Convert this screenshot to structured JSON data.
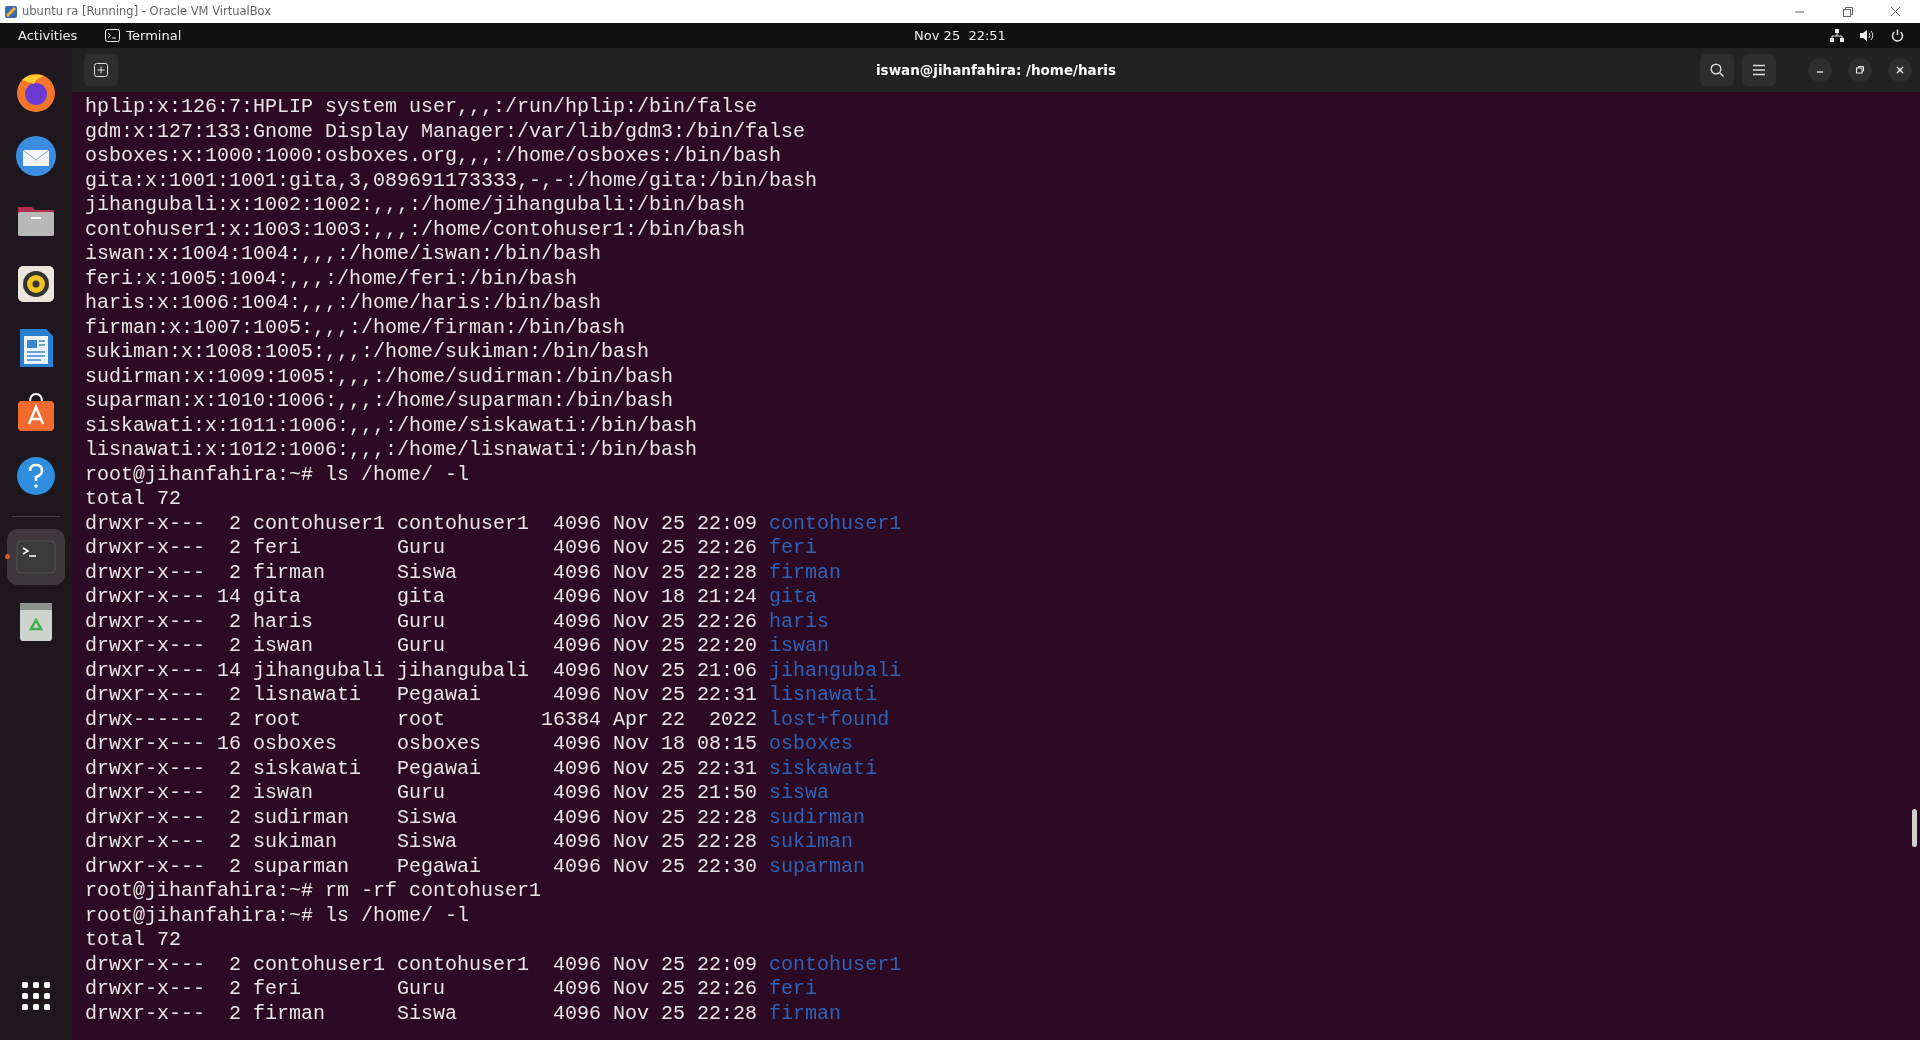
{
  "host_window": {
    "title": "ubuntu ra [Running] - Oracle VM VirtualBox"
  },
  "top_bar": {
    "activities": "Activities",
    "app": "Terminal",
    "clock": "Nov 25  22:51"
  },
  "dock": [
    {
      "kind": "browser",
      "selected": false
    },
    {
      "kind": "mail",
      "selected": false
    },
    {
      "kind": "files",
      "selected": false
    },
    {
      "kind": "music",
      "selected": false
    },
    {
      "kind": "writer",
      "selected": false
    },
    {
      "kind": "store",
      "selected": false
    },
    {
      "kind": "help",
      "selected": false
    },
    {
      "kind": "separator"
    },
    {
      "kind": "terminal",
      "selected": true
    },
    {
      "kind": "trash",
      "selected": false
    }
  ],
  "terminal": {
    "title": "iswan@jihanfahira: /home/haris",
    "lines": [
      {
        "kind": "plain",
        "text": "hplip:x:126:7:HPLIP system user,,,:/run/hplip:/bin/false"
      },
      {
        "kind": "plain",
        "text": "gdm:x:127:133:Gnome Display Manager:/var/lib/gdm3:/bin/false"
      },
      {
        "kind": "plain",
        "text": "osboxes:x:1000:1000:osboxes.org,,,:/home/osboxes:/bin/bash"
      },
      {
        "kind": "plain",
        "text": "gita:x:1001:1001:gita,3,089691173333,-,-:/home/gita:/bin/bash"
      },
      {
        "kind": "plain",
        "text": "jihangubali:x:1002:1002:,,,:/home/jihangubali:/bin/bash"
      },
      {
        "kind": "plain",
        "text": "contohuser1:x:1003:1003:,,,:/home/contohuser1:/bin/bash"
      },
      {
        "kind": "plain",
        "text": "iswan:x:1004:1004:,,,:/home/iswan:/bin/bash"
      },
      {
        "kind": "plain",
        "text": "feri:x:1005:1004:,,,:/home/feri:/bin/bash"
      },
      {
        "kind": "plain",
        "text": "haris:x:1006:1004:,,,:/home/haris:/bin/bash"
      },
      {
        "kind": "plain",
        "text": "firman:x:1007:1005:,,,:/home/firman:/bin/bash"
      },
      {
        "kind": "plain",
        "text": "sukiman:x:1008:1005:,,,:/home/sukiman:/bin/bash"
      },
      {
        "kind": "plain",
        "text": "sudirman:x:1009:1005:,,,:/home/sudirman:/bin/bash"
      },
      {
        "kind": "plain",
        "text": "suparman:x:1010:1006:,,,:/home/suparman:/bin/bash"
      },
      {
        "kind": "plain",
        "text": "siskawati:x:1011:1006:,,,:/home/siskawati:/bin/bash"
      },
      {
        "kind": "plain",
        "text": "lisnawati:x:1012:1006:,,,:/home/lisnawati:/bin/bash"
      },
      {
        "kind": "plain",
        "text": "root@jihanfahira:~# ls /home/ -l"
      },
      {
        "kind": "plain",
        "text": "total 72"
      },
      {
        "kind": "listing",
        "text": "drwxr-x---  2 contohuser1 contohuser1  4096 Nov 25 22:09",
        "name": "contohuser1"
      },
      {
        "kind": "listing",
        "text": "drwxr-x---  2 feri        Guru         4096 Nov 25 22:26",
        "name": "feri"
      },
      {
        "kind": "listing",
        "text": "drwxr-x---  2 firman      Siswa        4096 Nov 25 22:28",
        "name": "firman"
      },
      {
        "kind": "listing",
        "text": "drwxr-x--- 14 gita        gita         4096 Nov 18 21:24",
        "name": "gita"
      },
      {
        "kind": "listing",
        "text": "drwxr-x---  2 haris       Guru         4096 Nov 25 22:26",
        "name": "haris"
      },
      {
        "kind": "listing",
        "text": "drwxr-x---  2 iswan       Guru         4096 Nov 25 22:20",
        "name": "iswan"
      },
      {
        "kind": "listing",
        "text": "drwxr-x--- 14 jihangubali jihangubali  4096 Nov 25 21:06",
        "name": "jihangubali"
      },
      {
        "kind": "listing",
        "text": "drwxr-x---  2 lisnawati   Pegawai      4096 Nov 25 22:31",
        "name": "lisnawati"
      },
      {
        "kind": "listing",
        "text": "drwx------  2 root        root        16384 Apr 22  2022",
        "name": "lost+found"
      },
      {
        "kind": "listing",
        "text": "drwxr-x--- 16 osboxes     osboxes      4096 Nov 18 08:15",
        "name": "osboxes"
      },
      {
        "kind": "listing",
        "text": "drwxr-x---  2 siskawati   Pegawai      4096 Nov 25 22:31",
        "name": "siskawati"
      },
      {
        "kind": "listing",
        "text": "drwxr-x---  2 iswan       Guru         4096 Nov 25 21:50",
        "name": "siswa"
      },
      {
        "kind": "listing",
        "text": "drwxr-x---  2 sudirman    Siswa        4096 Nov 25 22:28",
        "name": "sudirman"
      },
      {
        "kind": "listing",
        "text": "drwxr-x---  2 sukiman     Siswa        4096 Nov 25 22:28",
        "name": "sukiman"
      },
      {
        "kind": "listing",
        "text": "drwxr-x---  2 suparman    Pegawai      4096 Nov 25 22:30",
        "name": "suparman"
      },
      {
        "kind": "plain",
        "text": "root@jihanfahira:~# rm -rf contohuser1"
      },
      {
        "kind": "plain",
        "text": "root@jihanfahira:~# ls /home/ -l"
      },
      {
        "kind": "plain",
        "text": "total 72"
      },
      {
        "kind": "listing",
        "text": "drwxr-x---  2 contohuser1 contohuser1  4096 Nov 25 22:09",
        "name": "contohuser1"
      },
      {
        "kind": "listing",
        "text": "drwxr-x---  2 feri        Guru         4096 Nov 25 22:26",
        "name": "feri"
      },
      {
        "kind": "listing",
        "text": "drwxr-x---  2 firman      Siswa        4096 Nov 25 22:28",
        "name": "firman"
      }
    ]
  }
}
